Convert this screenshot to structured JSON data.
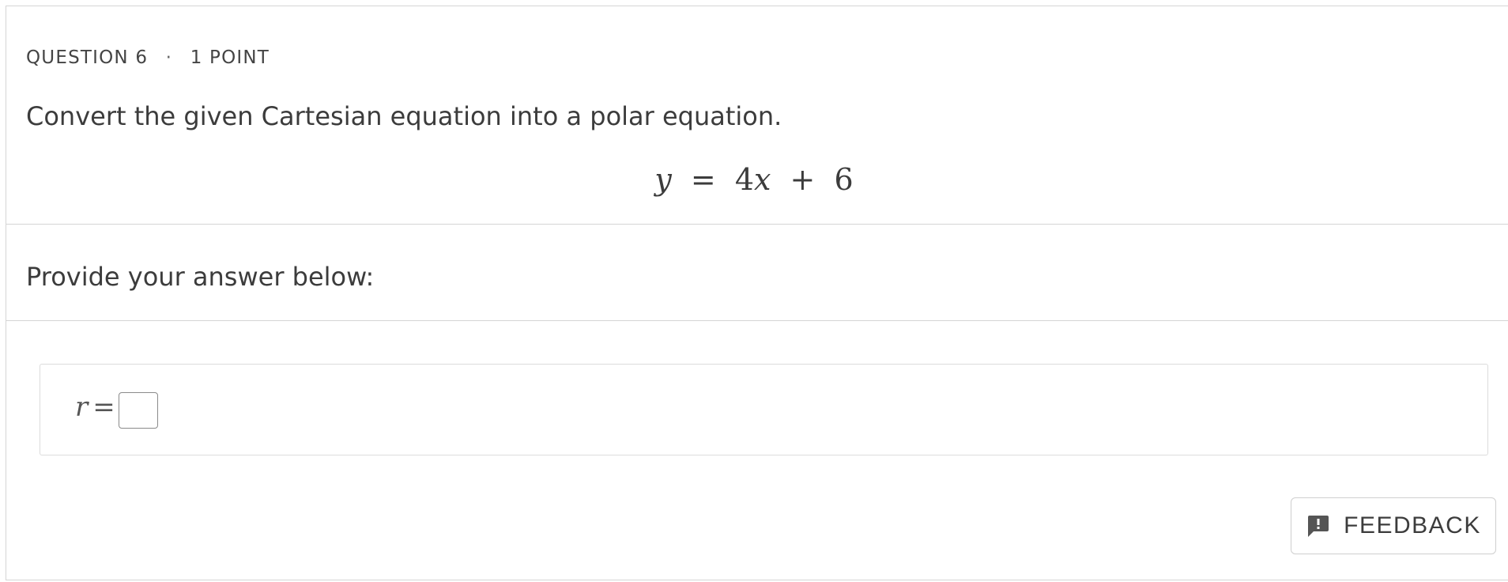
{
  "question": {
    "number_label": "QUESTION 6",
    "separator": "·",
    "points_label": "1 POINT",
    "prompt": "Convert the given Cartesian equation into a polar equation.",
    "equation": {
      "lhs": "y",
      "eq": "=",
      "term1_coef": "4",
      "term1_var": "x",
      "plus": "+",
      "const": "6"
    }
  },
  "answer": {
    "label": "Provide your answer below:",
    "var": "r",
    "eq": "=",
    "value": ""
  },
  "feedback": {
    "label": "FEEDBACK",
    "icon": "feedback-icon"
  }
}
